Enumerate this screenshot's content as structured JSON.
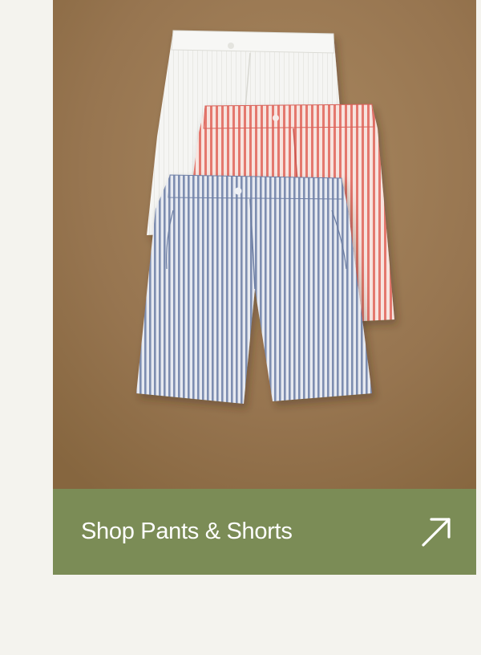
{
  "promo": {
    "image_alt": "White, red and blue seersucker shorts laid out on a tan background",
    "cta_label": "Shop Pants & Shorts",
    "cta_icon": "arrow-up-right-icon"
  },
  "colors": {
    "page_background": "#f4f3ee",
    "photo_background": "#9c7a56",
    "cta_background": "#7b8c56",
    "cta_text": "#ffffff"
  }
}
